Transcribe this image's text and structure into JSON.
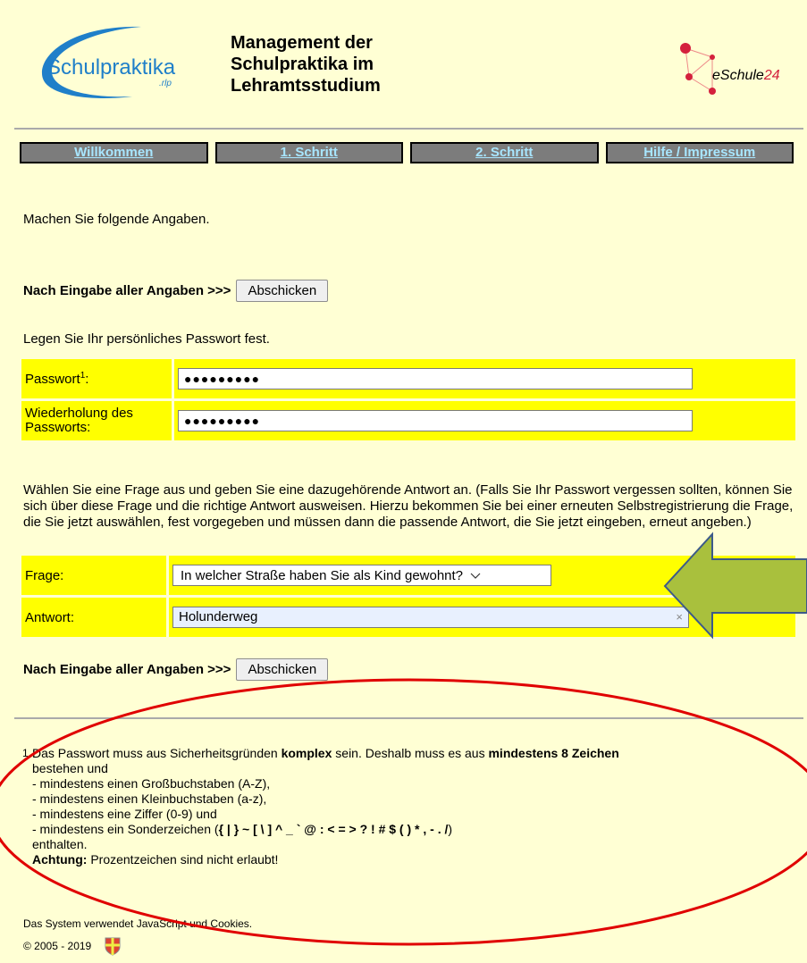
{
  "header": {
    "logo_left_text": "Schulpraktika",
    "logo_left_sub": ".rlp",
    "title_line1": "Management der",
    "title_line2": "Schulpraktika im",
    "title_line3": "Lehramtsstudium",
    "logo_right_prefix": "eSchule",
    "logo_right_suffix": "24"
  },
  "nav": {
    "items": [
      {
        "label": "Willkommen"
      },
      {
        "label": "1. Schritt"
      },
      {
        "label": "2. Schritt"
      },
      {
        "label": "Hilfe / Impressum"
      }
    ]
  },
  "main": {
    "intro": "Machen Sie folgende Angaben.",
    "submit_prefix": "Nach Eingabe aller Angaben >>>",
    "submit_label": "Abschicken",
    "password_intro": "Legen Sie Ihr persönliches Passwort fest.",
    "password_label": "Passwort",
    "password_sup": "1",
    "password_colon": ":",
    "password_value": "●●●●●●●●●",
    "repeat_label_line1": "Wiederholung des",
    "repeat_label_line2": "Passworts:",
    "repeat_value": "●●●●●●●●●",
    "question_intro": "Wählen Sie eine Frage aus und geben Sie eine dazugehörende Antwort an. (Falls Sie Ihr Passwort vergessen sollten, können Sie sich über diese Frage und die richtige Antwort ausweisen. Hierzu bekommen Sie bei einer erneuten Selbstregistrierung die Frage, die Sie jetzt auswählen, fest vorgegeben und müssen dann die passende Antwort, die Sie jetzt eingeben, erneut angeben.)",
    "question_label": "Frage:",
    "question_value": "In welcher Straße haben Sie als Kind gewohnt?",
    "answer_label": "Antwort:",
    "answer_value": "Holunderweg",
    "clear_glyph": "×"
  },
  "footnote": {
    "number": "1",
    "line1_a": "Das Passwort muss aus Sicherheitsgründen ",
    "line1_b": "komplex",
    "line1_c": " sein. Deshalb muss es aus ",
    "line1_d": "mindestens 8 Zeichen",
    "line2": "bestehen und",
    "line3": "- mindestens einen Großbuchstaben (A-Z),",
    "line4": "- mindestens einen Kleinbuchstaben (a-z),",
    "line5": "- mindestens eine Ziffer (0-9) und",
    "line6_a": "- mindestens ein Sonderzeichen (",
    "line6_b": "{ | } ~ [ \\ ] ^ _ ` @ : < = > ? ! # $ ( ) * , - . /",
    "line6_c": ")",
    "line7": "enthalten.",
    "line8_a": "Achtung:",
    "line8_b": " Prozentzeichen sind nicht erlaubt!"
  },
  "bottom": {
    "system_note": "Das System verwendet JavaScript und Cookies.",
    "copyright": "© 2005 - 2019"
  },
  "colors": {
    "background": "#ffffd4",
    "form_cell": "#ffff00",
    "nav_bg": "#7c7c7c",
    "nav_text": "#a8e6ff",
    "annotation_red": "#e00000",
    "arrow_fill": "#a9c03d",
    "arrow_stroke": "#3c5a8a"
  }
}
